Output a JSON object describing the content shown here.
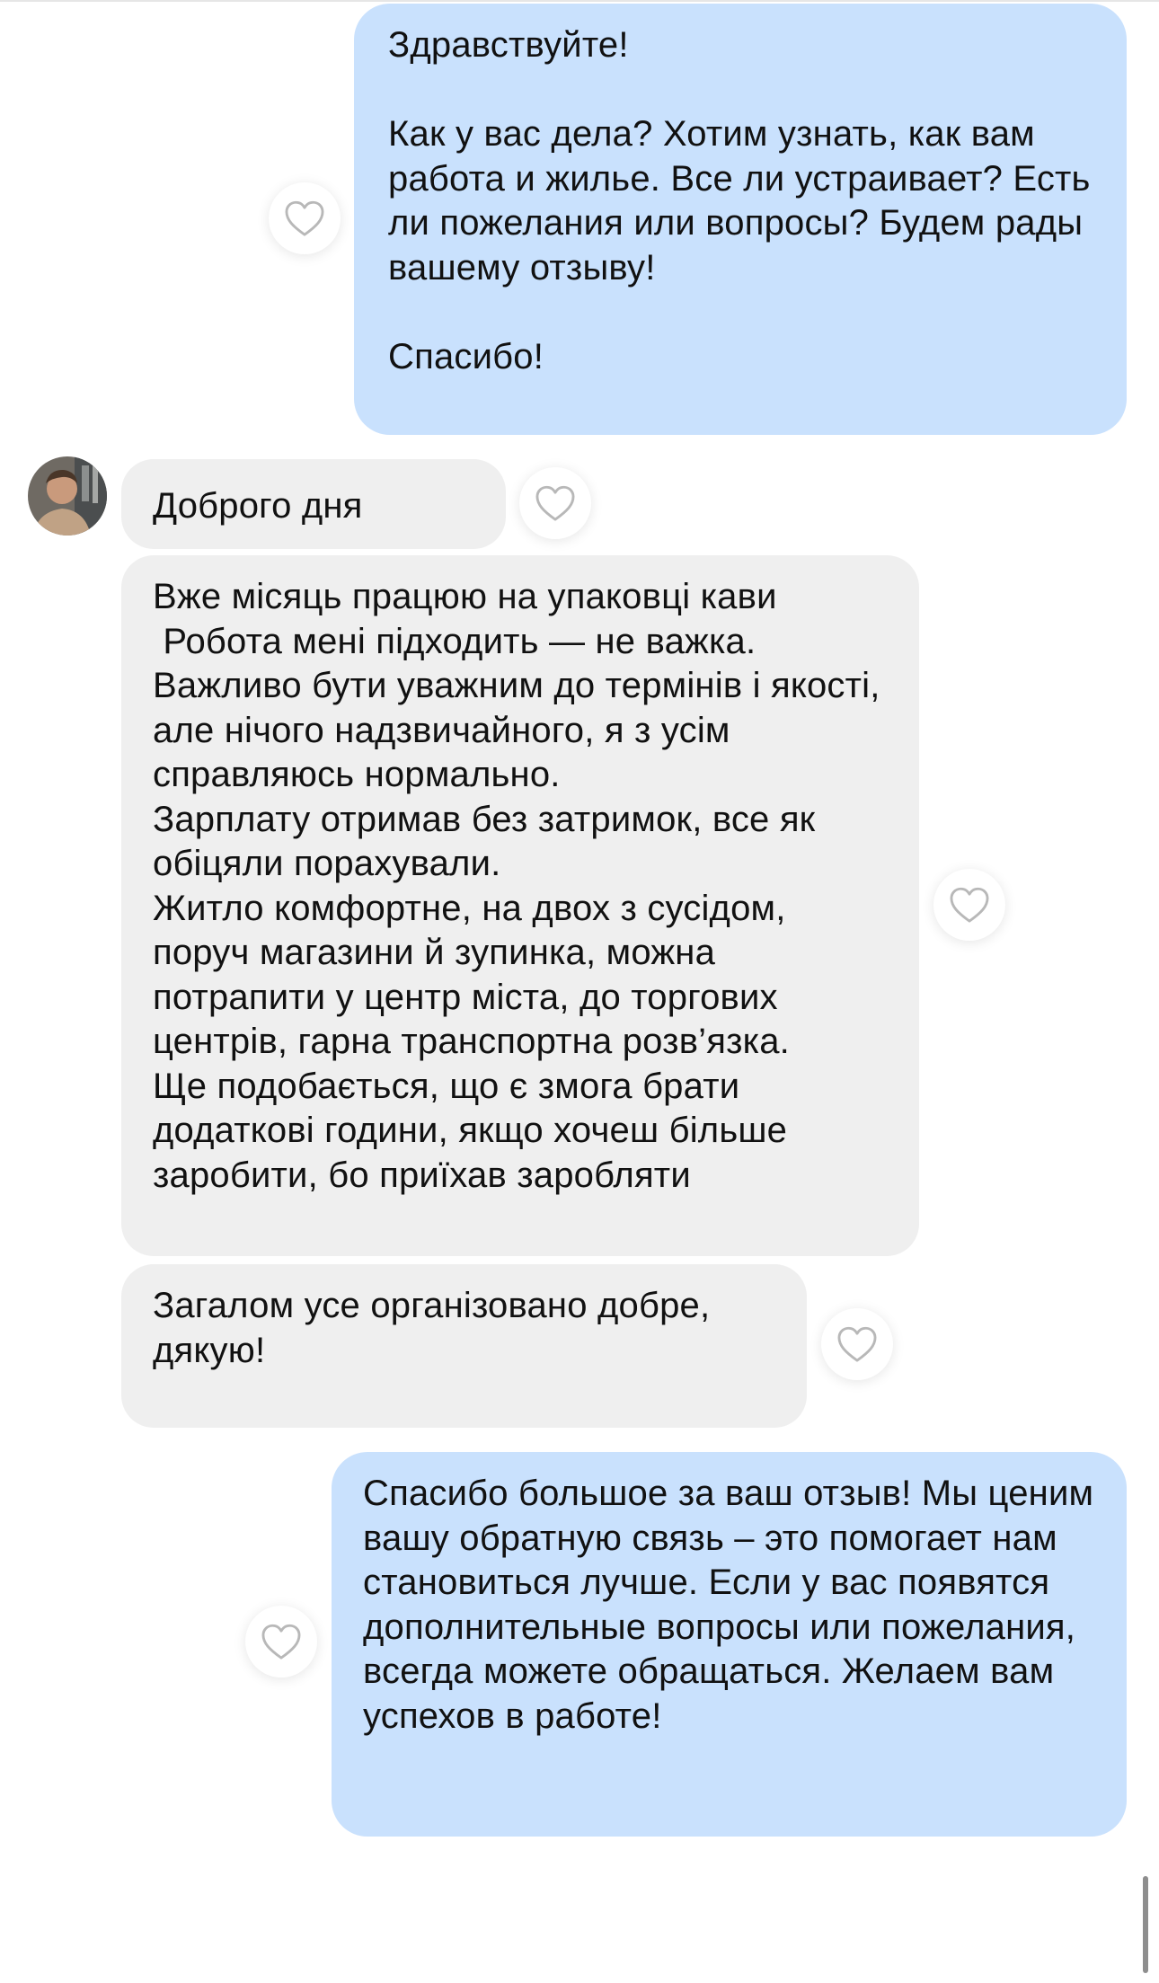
{
  "chat": {
    "messages": [
      {
        "direction": "outgoing",
        "text": "Здравствуйте!\n\nКак у вас дела? Хотим узнать, как вам работа и жилье. Все ли устраивает? Есть ли пожелания или вопросы? Будем рады вашему отзыву!\n\nСпасибо!"
      },
      {
        "direction": "incoming",
        "text": "Доброго дня"
      },
      {
        "direction": "incoming",
        "text": "Вже місяць працюю на упаковці кави\n Робота мені підходить — не важка. Важливо бути уважним до термінів і якості, але нічого надзвичайного, я з усім справляюсь нормально.\nЗарплату отримав без затримок, все як обіцяли порахували.\nЖитло комфортне, на двох з сусідом, поруч магазини й зупинка, можна потрапити у центр міста, до торгових центрів, гарна транспортна розв’язка.\nЩе подобається, що є змога брати додаткові години, якщо хочеш більше заробити, бо приїхав заробляти"
      },
      {
        "direction": "incoming",
        "text": "Загалом усе організовано добре, дякую!"
      },
      {
        "direction": "outgoing",
        "text": "Спасибо большое за ваш отзыв! Мы ценим вашу обратную связь – это помогает нам становиться лучше. Если у вас появятся дополнительные вопросы или пожелания, всегда можете обращаться. Желаем вам успехов в работе!"
      }
    ]
  },
  "icons": {
    "like": "heart-outline-icon",
    "avatar": "contact-avatar-photo"
  },
  "colors": {
    "outgoing_bubble": "#c9e1fd",
    "incoming_bubble": "#efefef",
    "heart_stroke": "#b8b8b8"
  }
}
